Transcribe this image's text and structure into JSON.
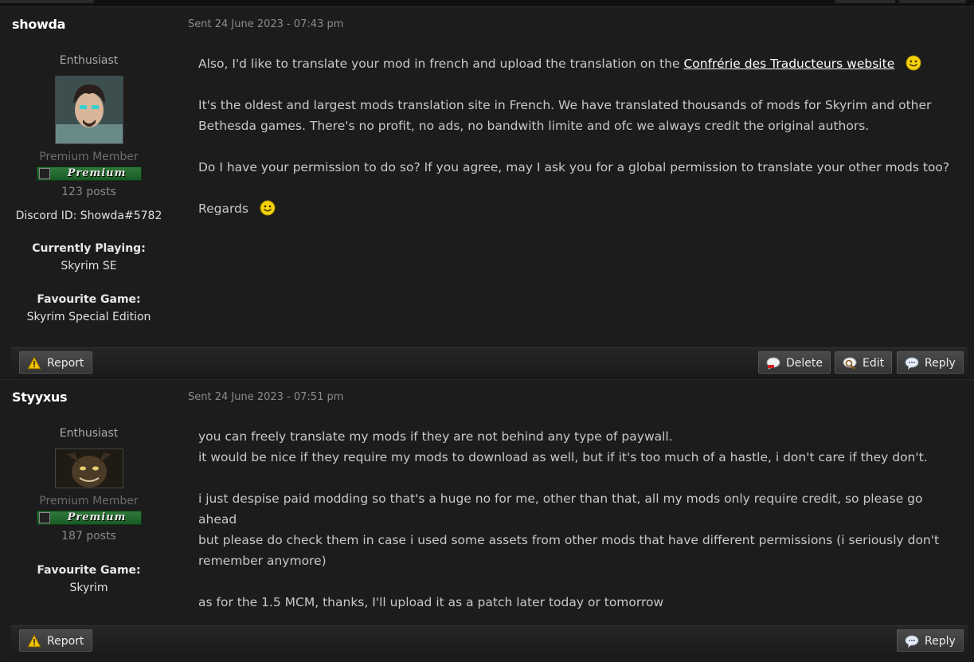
{
  "posts": [
    {
      "author": "showda",
      "date": "Sent 24 June 2023 - 07:43 pm",
      "rank": "Enthusiast",
      "member_group": "Premium Member",
      "badge": "Premium",
      "posts_count": "123 posts",
      "discord": "Discord ID: Showda#5782",
      "currently_playing_label": "Currently Playing:",
      "currently_playing": "Skyrim SE",
      "favourite_game_label": "Favourite Game:",
      "favourite_game": "Skyrim Special Edition",
      "content": {
        "p1_text": "Also, I'd like to translate your mod in french and upload the translation on the ",
        "p1_link": "Confrérie des Traducteurs website",
        "p2": "It's the oldest and largest mods translation site in French. We have translated thousands of mods for Skyrim and other Bethesda games. There's no profit, no ads, no bandwith limite and ofc we always credit the original authors.",
        "p3": "Do I have your permission to do so? If you agree, may I ask you for a global permission to translate your other mods too?",
        "p4": "Regards"
      },
      "actions": {
        "report": "Report",
        "delete": "Delete",
        "edit": "Edit",
        "reply": "Reply"
      }
    },
    {
      "author": "Styyxus",
      "date": "Sent 24 June 2023 - 07:51 pm",
      "rank": "Enthusiast",
      "member_group": "Premium Member",
      "badge": "Premium",
      "posts_count": "187 posts",
      "favourite_game_label": "Favourite Game:",
      "favourite_game": "Skyrim",
      "content": {
        "l1": "you can freely translate my mods if they are not behind any type of paywall.",
        "l2": "it would be nice if they require my mods to download as well, but if it's too much of a hastle, i don't care if they don't.",
        "l3": "i just despise paid modding so that's a huge no for me, other than that, all my mods only require credit, so please go ahead",
        "l4": "but please do check them in case i used some assets from other mods that have different permissions (i seriously don't remember anymore)",
        "l5": "as for the 1.5 MCM, thanks, I'll upload it as a patch later today or tomorrow"
      },
      "actions": {
        "report": "Report",
        "reply": "Reply"
      }
    }
  ],
  "icons": {
    "report": "warning-icon",
    "delete": "delete-bubble-icon",
    "edit": "edit-magnifier-icon",
    "reply": "reply-bubble-icon",
    "smiley": "smiley-icon"
  }
}
